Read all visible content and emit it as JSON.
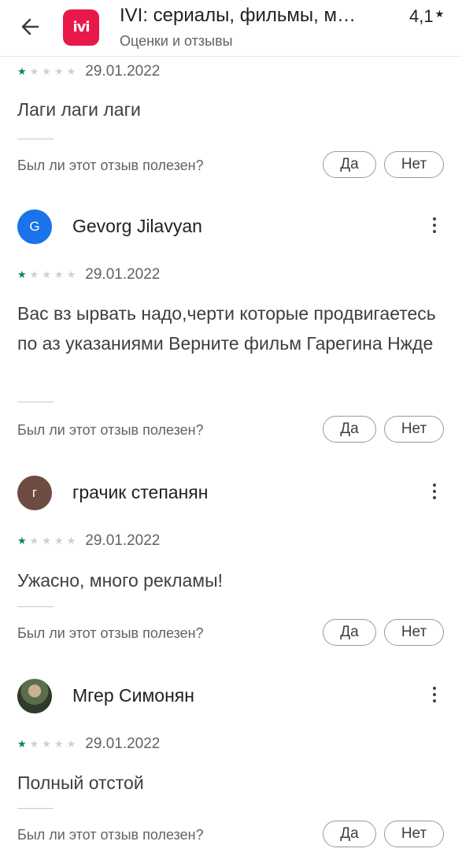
{
  "header": {
    "app_icon_text": "ivi",
    "title": "IVI: сериалы, фильмы, м…",
    "subtitle": "Оценки и отзывы",
    "rating": "4,1",
    "rating_star": "★",
    "accent_color": "#e8194a"
  },
  "review0": {
    "stars_filled": 1,
    "stars_total": 5,
    "date": "29.01.2022",
    "text": "Лаги лаги лаги",
    "helpful_question": "Был ли этот отзыв полезен?",
    "yes_label": "Да",
    "no_label": "Нет"
  },
  "reviews": [
    {
      "avatar_letter": "G",
      "avatar_color": "#1a73e8",
      "name": "Gevorg Jilavyan",
      "stars_filled": 1,
      "stars_total": 5,
      "date": "29.01.2022",
      "text": "Вас вз ырвать надо,черти которые продвигаетесь по аз указаниями Верните фильм Гарегина Нжде",
      "helpful_question": "Был ли этот отзыв полезен?",
      "yes_label": "Да",
      "no_label": "Нет"
    },
    {
      "avatar_letter": "г",
      "avatar_color": "#6d4c41",
      "name": "грачик степанян",
      "stars_filled": 1,
      "stars_total": 5,
      "date": "29.01.2022",
      "text": "Ужасно, много рекламы!",
      "helpful_question": "Был ли этот отзыв полезен?",
      "yes_label": "Да",
      "no_label": "Нет"
    },
    {
      "avatar_letter": "",
      "avatar_color": "#4a5a3c",
      "name": "Мгер Симонян",
      "stars_filled": 1,
      "stars_total": 5,
      "date": "29.01.2022",
      "text": "Полный отстой",
      "helpful_question": "Был ли этот отзыв полезен?",
      "yes_label": "Да",
      "no_label": "Нет"
    }
  ]
}
